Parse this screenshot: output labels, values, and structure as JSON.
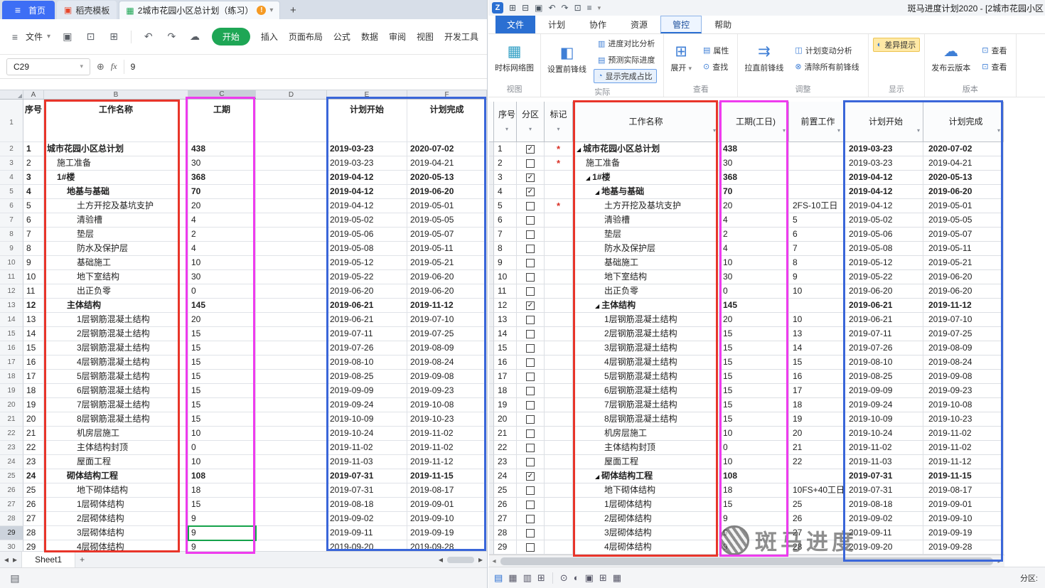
{
  "icons": {
    "menu": "≡",
    "save": "▣",
    "print": "⊡",
    "preview": "⊞",
    "undo": "↶",
    "redo": "↷",
    "cloud": "☁",
    "dropdown": "▾",
    "plus": "+",
    "zoom": "⊕",
    "warning": "!",
    "corner": "◢",
    "nav_left": "◂",
    "nav_right": "▸",
    "filter": "▾",
    "check": "✓",
    "collapse": "◢",
    "zlogo": "Z",
    "new": "⊞",
    "open": "⊟",
    "settings": "≡",
    "sheet": "▦",
    "net": "▦",
    "forefront": "◧",
    "compare": "▥",
    "predict": "▤",
    "percent": "◔",
    "expand": "⊞",
    "props": "▤",
    "find": "⊙",
    "straighten": "⇉",
    "change": "◫",
    "clear": "⊗",
    "diff": "◐",
    "view": "⊡",
    "grid1": "▤",
    "grid2": "▦",
    "grid3": "▥",
    "grid4": "⊞",
    "half": "◐",
    "doc": "▣",
    "close": "×"
  },
  "wps": {
    "tab_bar": {
      "home": "首页",
      "template": "稻壳模板",
      "document": "2城市花园小区总计划（练习）"
    },
    "menu": {
      "file": "文件",
      "ribbon_tabs": [
        "开始",
        "插入",
        "页面布局",
        "公式",
        "数据",
        "审阅",
        "视图",
        "开发工具"
      ],
      "active": "开始"
    },
    "formula_bar": {
      "name_box": "C29",
      "fx": "fx",
      "value": "9"
    },
    "columns": [
      "A",
      "B",
      "C",
      "D",
      "E",
      "F"
    ],
    "first_row_label": "1",
    "header_row": [
      "序号",
      "工作名称",
      "工期",
      "",
      "计划开始",
      "计划完成"
    ],
    "selected": {
      "cell": "C29",
      "column": "C",
      "row": 29
    },
    "sheet_bar": {
      "tab": "Sheet1",
      "add": "+"
    }
  },
  "zebra": {
    "title": "斑马进度计划2020 - [2城市花园小区",
    "menu_tabs": [
      "文件",
      "计划",
      "协作",
      "资源",
      "管控",
      "帮助"
    ],
    "active_tab": "管控",
    "ribbon_groups": [
      {
        "label": "视图",
        "big": [
          "时标网络图"
        ],
        "small": []
      },
      {
        "label": "实际",
        "big": [
          "设置前锋线"
        ],
        "small": [
          "进度对比分析",
          "预测实际进度",
          "显示完成占比"
        ]
      },
      {
        "label": "查看",
        "big": [
          "展开"
        ],
        "small": [
          "属性",
          "查找"
        ]
      },
      {
        "label": "调整",
        "big": [
          "拉直前锋线"
        ],
        "small": [
          "计划变动分析",
          "清除所有前锋线"
        ]
      },
      {
        "label": "显示",
        "big": [],
        "small": [
          "差异提示"
        ]
      },
      {
        "label": "版本",
        "big": [
          "发布云版本"
        ],
        "small": [
          "查看",
          "查看"
        ]
      }
    ],
    "table_headers": [
      "序号",
      "分区",
      "标记",
      "工作名称",
      "工期(工日)",
      "前置工作",
      "计划开始",
      "计划完成"
    ],
    "status_bar": {
      "partition_label": "分区:"
    }
  },
  "watermark": {
    "text": "斑马进度"
  },
  "rows": [
    {
      "num": 1,
      "name": "城市花园小区总计划",
      "lvl": 0,
      "sum": true,
      "dur": "438",
      "pred": "",
      "start": "2019-03-23",
      "end": "2020-07-02",
      "chk": true,
      "mark": "*"
    },
    {
      "num": 2,
      "name": "施工准备",
      "lvl": 1,
      "sum": false,
      "dur": "30",
      "pred": "",
      "start": "2019-03-23",
      "end": "2019-04-21",
      "chk": false,
      "mark": "*"
    },
    {
      "num": 3,
      "name": "1#楼",
      "lvl": 1,
      "sum": true,
      "dur": "368",
      "pred": "",
      "start": "2019-04-12",
      "end": "2020-05-13",
      "chk": true,
      "mark": ""
    },
    {
      "num": 4,
      "name": "地基与基础",
      "lvl": 2,
      "sum": true,
      "dur": "70",
      "pred": "",
      "start": "2019-04-12",
      "end": "2019-06-20",
      "chk": true,
      "mark": ""
    },
    {
      "num": 5,
      "name": "土方开挖及基坑支护",
      "lvl": 3,
      "sum": false,
      "dur": "20",
      "pred": "2FS-10工日",
      "start": "2019-04-12",
      "end": "2019-05-01",
      "chk": false,
      "mark": "*"
    },
    {
      "num": 6,
      "name": "清验槽",
      "lvl": 3,
      "sum": false,
      "dur": "4",
      "pred": "5",
      "start": "2019-05-02",
      "end": "2019-05-05",
      "chk": false,
      "mark": ""
    },
    {
      "num": 7,
      "name": "垫层",
      "lvl": 3,
      "sum": false,
      "dur": "2",
      "pred": "6",
      "start": "2019-05-06",
      "end": "2019-05-07",
      "chk": false,
      "mark": ""
    },
    {
      "num": 8,
      "name": "防水及保护层",
      "lvl": 3,
      "sum": false,
      "dur": "4",
      "pred": "7",
      "start": "2019-05-08",
      "end": "2019-05-11",
      "chk": false,
      "mark": ""
    },
    {
      "num": 9,
      "name": "基础施工",
      "lvl": 3,
      "sum": false,
      "dur": "10",
      "pred": "8",
      "start": "2019-05-12",
      "end": "2019-05-21",
      "chk": false,
      "mark": ""
    },
    {
      "num": 10,
      "name": "地下室结构",
      "lvl": 3,
      "sum": false,
      "dur": "30",
      "pred": "9",
      "start": "2019-05-22",
      "end": "2019-06-20",
      "chk": false,
      "mark": ""
    },
    {
      "num": 11,
      "name": "出正负零",
      "lvl": 3,
      "sum": false,
      "dur": "0",
      "pred": "10",
      "start": "2019-06-20",
      "end": "2019-06-20",
      "chk": false,
      "mark": ""
    },
    {
      "num": 12,
      "name": "主体结构",
      "lvl": 2,
      "sum": true,
      "dur": "145",
      "pred": "",
      "start": "2019-06-21",
      "end": "2019-11-12",
      "chk": true,
      "mark": ""
    },
    {
      "num": 13,
      "name": "1层钢筋混凝土结构",
      "lvl": 3,
      "sum": false,
      "dur": "20",
      "pred": "10",
      "start": "2019-06-21",
      "end": "2019-07-10",
      "chk": false,
      "mark": ""
    },
    {
      "num": 14,
      "name": "2层钢筋混凝土结构",
      "lvl": 3,
      "sum": false,
      "dur": "15",
      "pred": "13",
      "start": "2019-07-11",
      "end": "2019-07-25",
      "chk": false,
      "mark": ""
    },
    {
      "num": 15,
      "name": "3层钢筋混凝土结构",
      "lvl": 3,
      "sum": false,
      "dur": "15",
      "pred": "14",
      "start": "2019-07-26",
      "end": "2019-08-09",
      "chk": false,
      "mark": ""
    },
    {
      "num": 16,
      "name": "4层钢筋混凝土结构",
      "lvl": 3,
      "sum": false,
      "dur": "15",
      "pred": "15",
      "start": "2019-08-10",
      "end": "2019-08-24",
      "chk": false,
      "mark": ""
    },
    {
      "num": 17,
      "name": "5层钢筋混凝土结构",
      "lvl": 3,
      "sum": false,
      "dur": "15",
      "pred": "16",
      "start": "2019-08-25",
      "end": "2019-09-08",
      "chk": false,
      "mark": ""
    },
    {
      "num": 18,
      "name": "6层钢筋混凝土结构",
      "lvl": 3,
      "sum": false,
      "dur": "15",
      "pred": "17",
      "start": "2019-09-09",
      "end": "2019-09-23",
      "chk": false,
      "mark": ""
    },
    {
      "num": 19,
      "name": "7层钢筋混凝土结构",
      "lvl": 3,
      "sum": false,
      "dur": "15",
      "pred": "18",
      "start": "2019-09-24",
      "end": "2019-10-08",
      "chk": false,
      "mark": ""
    },
    {
      "num": 20,
      "name": "8层钢筋混凝土结构",
      "lvl": 3,
      "sum": false,
      "dur": "15",
      "pred": "19",
      "start": "2019-10-09",
      "end": "2019-10-23",
      "chk": false,
      "mark": ""
    },
    {
      "num": 21,
      "name": "机房层施工",
      "lvl": 3,
      "sum": false,
      "dur": "10",
      "pred": "20",
      "start": "2019-10-24",
      "end": "2019-11-02",
      "chk": false,
      "mark": ""
    },
    {
      "num": 22,
      "name": "主体结构封顶",
      "lvl": 3,
      "sum": false,
      "dur": "0",
      "pred": "21",
      "start": "2019-11-02",
      "end": "2019-11-02",
      "chk": false,
      "mark": ""
    },
    {
      "num": 23,
      "name": "屋面工程",
      "lvl": 3,
      "sum": false,
      "dur": "10",
      "pred": "22",
      "start": "2019-11-03",
      "end": "2019-11-12",
      "chk": false,
      "mark": ""
    },
    {
      "num": 24,
      "name": "砌体结构工程",
      "lvl": 2,
      "sum": true,
      "dur": "108",
      "pred": "",
      "start": "2019-07-31",
      "end": "2019-11-15",
      "chk": true,
      "mark": ""
    },
    {
      "num": 25,
      "name": "地下砌体结构",
      "lvl": 3,
      "sum": false,
      "dur": "18",
      "pred": "10FS+40工日",
      "start": "2019-07-31",
      "end": "2019-08-17",
      "chk": false,
      "mark": ""
    },
    {
      "num": 26,
      "name": "1层砌体结构",
      "lvl": 3,
      "sum": false,
      "dur": "15",
      "pred": "25",
      "start": "2019-08-18",
      "end": "2019-09-01",
      "chk": false,
      "mark": ""
    },
    {
      "num": 27,
      "name": "2层砌体结构",
      "lvl": 3,
      "sum": false,
      "dur": "9",
      "pred": "26",
      "start": "2019-09-02",
      "end": "2019-09-10",
      "chk": false,
      "mark": ""
    },
    {
      "num": 28,
      "name": "3层砌体结构",
      "lvl": 3,
      "sum": false,
      "dur": "9",
      "pred": "27",
      "start": "2019-09-11",
      "end": "2019-09-19",
      "chk": false,
      "mark": ""
    },
    {
      "num": 29,
      "name": "4层砌体结构",
      "lvl": 3,
      "sum": false,
      "dur": "9",
      "pred": "28",
      "start": "2019-09-20",
      "end": "2019-09-28",
      "chk": false,
      "mark": ""
    }
  ]
}
